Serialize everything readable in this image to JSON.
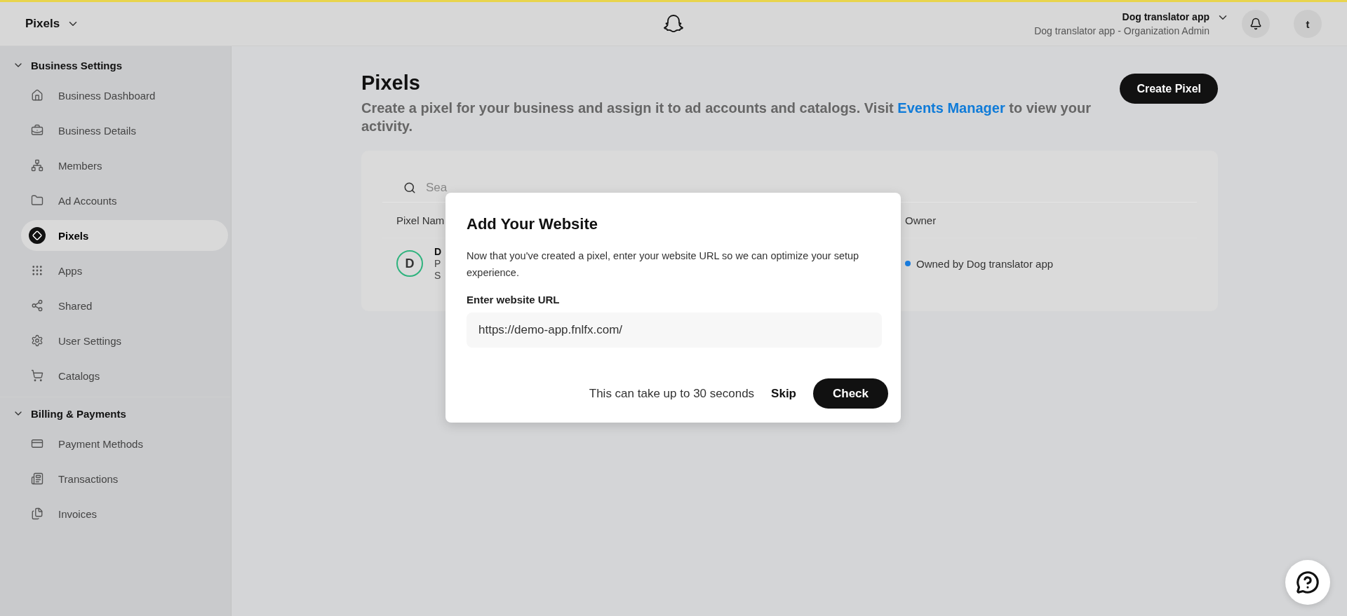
{
  "top_bar": {
    "title": "Pixels",
    "account_name": "Dog translator app",
    "account_role": "Dog translator app - Organization Admin",
    "avatar_initial": "t"
  },
  "sidebar": {
    "sections": [
      {
        "title": "Business Settings",
        "expanded": true,
        "items": [
          {
            "label": "Business Dashboard",
            "selected": false
          },
          {
            "label": "Business Details",
            "selected": false
          },
          {
            "label": "Members",
            "selected": false
          },
          {
            "label": "Ad Accounts",
            "selected": false
          },
          {
            "label": "Pixels",
            "selected": true
          },
          {
            "label": "Apps",
            "selected": false
          },
          {
            "label": "Shared",
            "selected": false
          },
          {
            "label": "User Settings",
            "selected": false
          },
          {
            "label": "Catalogs",
            "selected": false
          }
        ]
      },
      {
        "title": "Billing & Payments",
        "expanded": true,
        "items": [
          {
            "label": "Payment Methods",
            "selected": false
          },
          {
            "label": "Transactions",
            "selected": false
          },
          {
            "label": "Invoices",
            "selected": false
          }
        ]
      }
    ]
  },
  "page": {
    "title": "Pixels",
    "description_before": "Create a pixel for your business and assign it to ad accounts and catalogs. Visit ",
    "description_link": "Events Manager",
    "description_after": " to view your activity.",
    "create_button": "Create Pixel"
  },
  "table": {
    "search_placeholder": "Sea",
    "columns": [
      "Pixel Nam",
      "Owner"
    ],
    "rows": [
      {
        "avatar": "D",
        "name": "D",
        "line_2": "P",
        "line_3": "S",
        "owner": "Owned by Dog translator app",
        "color": "#1a7de0"
      }
    ]
  },
  "dialog": {
    "title": "Add Your Website",
    "description": "Now that you've created a pixel, enter your website URL so we can optimize your setup experience.",
    "field_label": "Enter website URL",
    "field_value": "https://demo-app.fnlfx.com/",
    "note": "This can take up to 30 seconds",
    "skip_button": "Skip",
    "check_button": "Check"
  }
}
